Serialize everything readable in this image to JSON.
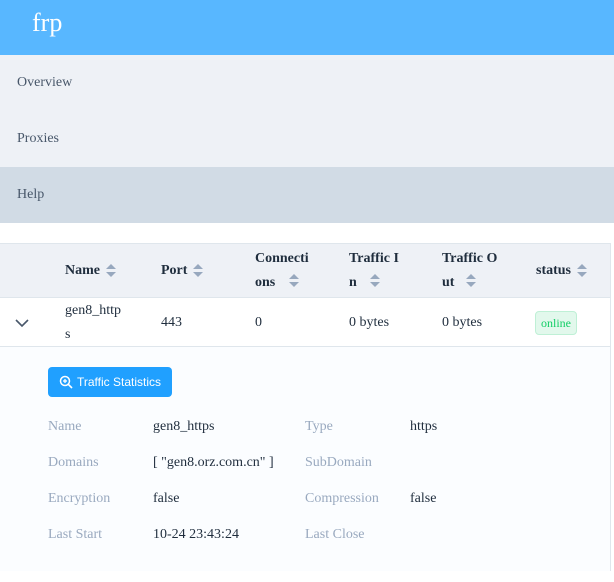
{
  "app": {
    "title": "frp"
  },
  "menu": {
    "items": [
      {
        "label": "Overview"
      },
      {
        "label": "Proxies"
      },
      {
        "label": "Help"
      }
    ]
  },
  "table": {
    "columns": {
      "name": "Name",
      "port": "Port",
      "connections": "Connecti\nons",
      "traffic_in": "Traffic I\nn",
      "traffic_out": "Traffic O\nut",
      "status": "status"
    },
    "rows": [
      {
        "name": "gen8_http\ns",
        "port": "443",
        "connections": "0",
        "traffic_in": "0 bytes",
        "traffic_out": "0 bytes",
        "status": "online"
      }
    ]
  },
  "detail": {
    "button_label": "Traffic Statistics",
    "fields": {
      "name_label": "Name",
      "name_value": "gen8_https",
      "type_label": "Type",
      "type_value": "https",
      "domains_label": "Domains",
      "domains_value": "[ \"gen8.orz.com.cn\" ]",
      "subdomain_label": "SubDomain",
      "subdomain_value": "",
      "encryption_label": "Encryption",
      "encryption_value": "false",
      "compression_label": "Compression",
      "compression_value": "false",
      "last_start_label": "Last Start",
      "last_start_value": "10-24 23:43:24",
      "last_close_label": "Last Close",
      "last_close_value": ""
    }
  },
  "colors": {
    "header": "#58b7ff",
    "menu_bg": "#eef1f6",
    "menu_active": "#d1dbe5",
    "primary": "#20a0ff",
    "success": "#13ce66"
  },
  "icons": {
    "expand": "chevron-down-icon",
    "button": "zoom-in-icon",
    "sort": "sort-caret-icon"
  }
}
